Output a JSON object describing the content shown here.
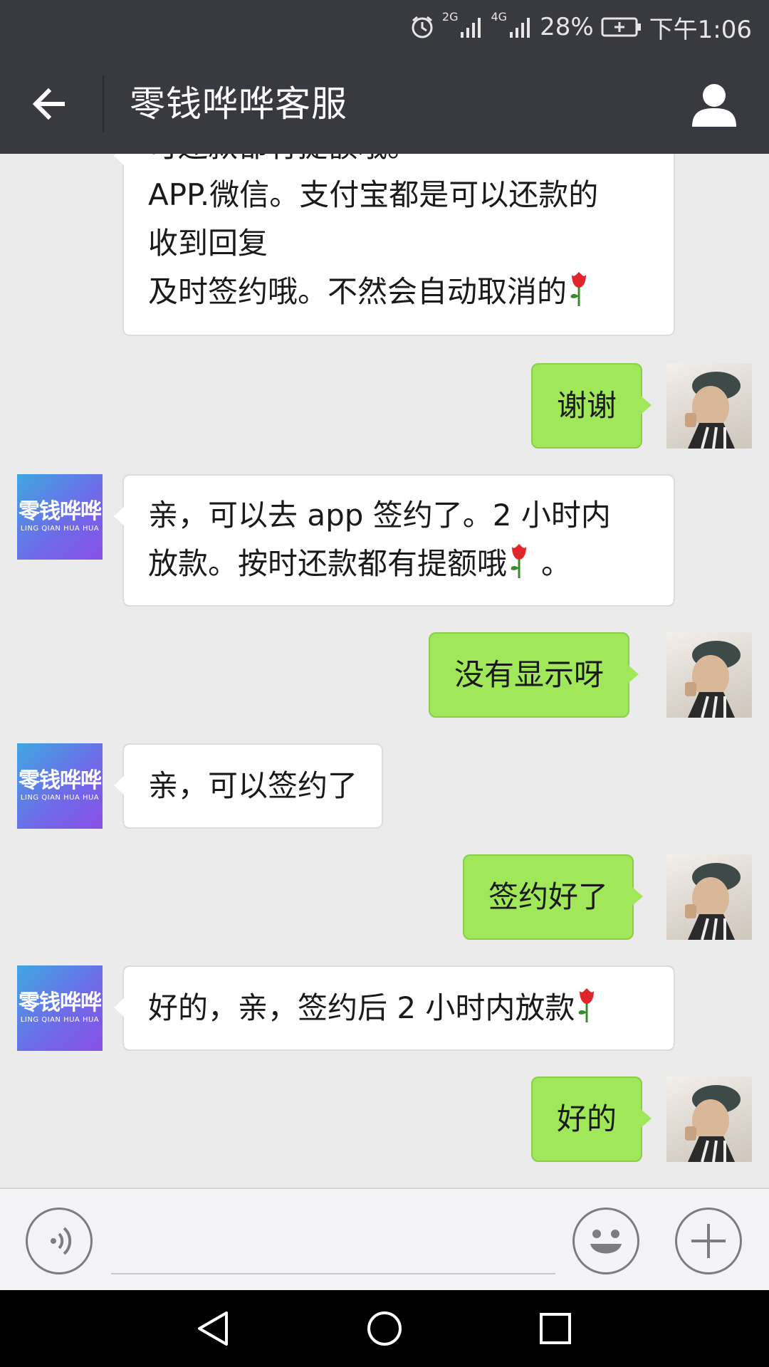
{
  "status_bar": {
    "network_1": "2G",
    "network_2": "4G",
    "battery": "28%",
    "time": "下午1:06",
    "icons": [
      "alarm-icon",
      "signal-icon",
      "battery-icon"
    ]
  },
  "header": {
    "title": "零钱哗哗客服",
    "back_icon": "back-arrow-icon",
    "profile_icon": "person-icon"
  },
  "messages": [
    {
      "side": "left",
      "lines": [
        "可还款都有提额哦。",
        "APP.微信。支付宝都是可以还款的",
        "收到回复",
        "及时签约哦。不然会自动取消的"
      ],
      "emoji": "rose"
    },
    {
      "side": "right",
      "lines": [
        "谢谢"
      ]
    },
    {
      "side": "left",
      "lines": [
        "亲，可以去 app 签约了。2 小时内",
        "放款。按时还款都有提额哦",
        "。"
      ],
      "emoji": "rose"
    },
    {
      "side": "right",
      "lines": [
        "没有显示呀"
      ]
    },
    {
      "side": "left",
      "lines": [
        "亲，可以签约了"
      ]
    },
    {
      "side": "right",
      "lines": [
        "签约好了"
      ]
    },
    {
      "side": "left",
      "lines": [
        "好的，亲，签约后 2 小时内放款"
      ],
      "emoji": "rose"
    },
    {
      "side": "right",
      "lines": [
        "好的"
      ]
    }
  ],
  "cs_avatar": {
    "logo": "零钱哗哗",
    "sub": "LING QIAN HUA HUA"
  },
  "input_bar": {
    "voice_icon": "voice-icon",
    "emoji_icon": "smiley-icon",
    "plus_icon": "plus-icon"
  },
  "nav_bar": {
    "icons": [
      "nav-back-icon",
      "nav-home-icon",
      "nav-recents-icon"
    ]
  },
  "colors": {
    "header": "#393a3f",
    "chat_bg": "#ebebeb",
    "sent_bubble": "#a0e75a",
    "received_bubble": "#ffffff"
  }
}
